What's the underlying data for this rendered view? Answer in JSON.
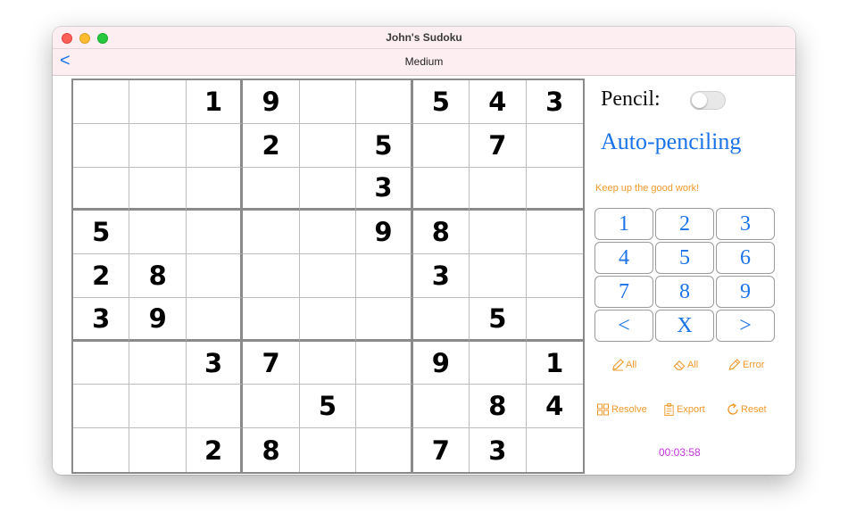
{
  "window": {
    "title": "John's Sudoku"
  },
  "nav": {
    "back_label": "<",
    "title": "Medium"
  },
  "board": [
    [
      "",
      "",
      "1",
      "9",
      "",
      "",
      "5",
      "4",
      "3"
    ],
    [
      "",
      "",
      "",
      "2",
      "",
      "5",
      "",
      "7",
      ""
    ],
    [
      "",
      "",
      "",
      "",
      "",
      "3",
      "",
      "",
      ""
    ],
    [
      "5",
      "",
      "",
      "",
      "",
      "9",
      "8",
      "",
      ""
    ],
    [
      "2",
      "8",
      "",
      "",
      "",
      "",
      "3",
      "",
      ""
    ],
    [
      "3",
      "9",
      "",
      "",
      "",
      "",
      "",
      "5",
      ""
    ],
    [
      "",
      "",
      "3",
      "7",
      "",
      "",
      "9",
      "",
      "1"
    ],
    [
      "",
      "",
      "",
      "",
      "5",
      "",
      "",
      "8",
      "4"
    ],
    [
      "",
      "",
      "2",
      "8",
      "",
      "",
      "7",
      "3",
      ""
    ]
  ],
  "pencil": {
    "label": "Pencil:",
    "enabled": false
  },
  "auto_penciling": {
    "label": "Auto-penciling"
  },
  "message": "Keep up the good work!",
  "numpad": [
    {
      "name": "key-1",
      "label": "1"
    },
    {
      "name": "key-2",
      "label": "2"
    },
    {
      "name": "key-3",
      "label": "3"
    },
    {
      "name": "key-4",
      "label": "4"
    },
    {
      "name": "key-5",
      "label": "5"
    },
    {
      "name": "key-6",
      "label": "6"
    },
    {
      "name": "key-7",
      "label": "7"
    },
    {
      "name": "key-8",
      "label": "8"
    },
    {
      "name": "key-9",
      "label": "9"
    },
    {
      "name": "key-prev",
      "label": "<"
    },
    {
      "name": "key-clear",
      "label": "X"
    },
    {
      "name": "key-next",
      "label": ">"
    }
  ],
  "tools": {
    "pencil_all": {
      "label": "All",
      "icon": "pencil-icon"
    },
    "erase_all": {
      "label": "All",
      "icon": "eraser-icon"
    },
    "error": {
      "label": "Error",
      "icon": "pencil-outline-icon"
    },
    "resolve": {
      "label": "Resolve",
      "icon": "puzzle-icon"
    },
    "export": {
      "label": "Export",
      "icon": "clipboard-icon"
    },
    "reset": {
      "label": "Reset",
      "icon": "reset-icon"
    }
  },
  "timer": "00:03:58",
  "colors": {
    "accent": "#1a73e8",
    "tool": "#f0992a",
    "timer": "#c133d9",
    "titlebar": "#fdeef2"
  }
}
